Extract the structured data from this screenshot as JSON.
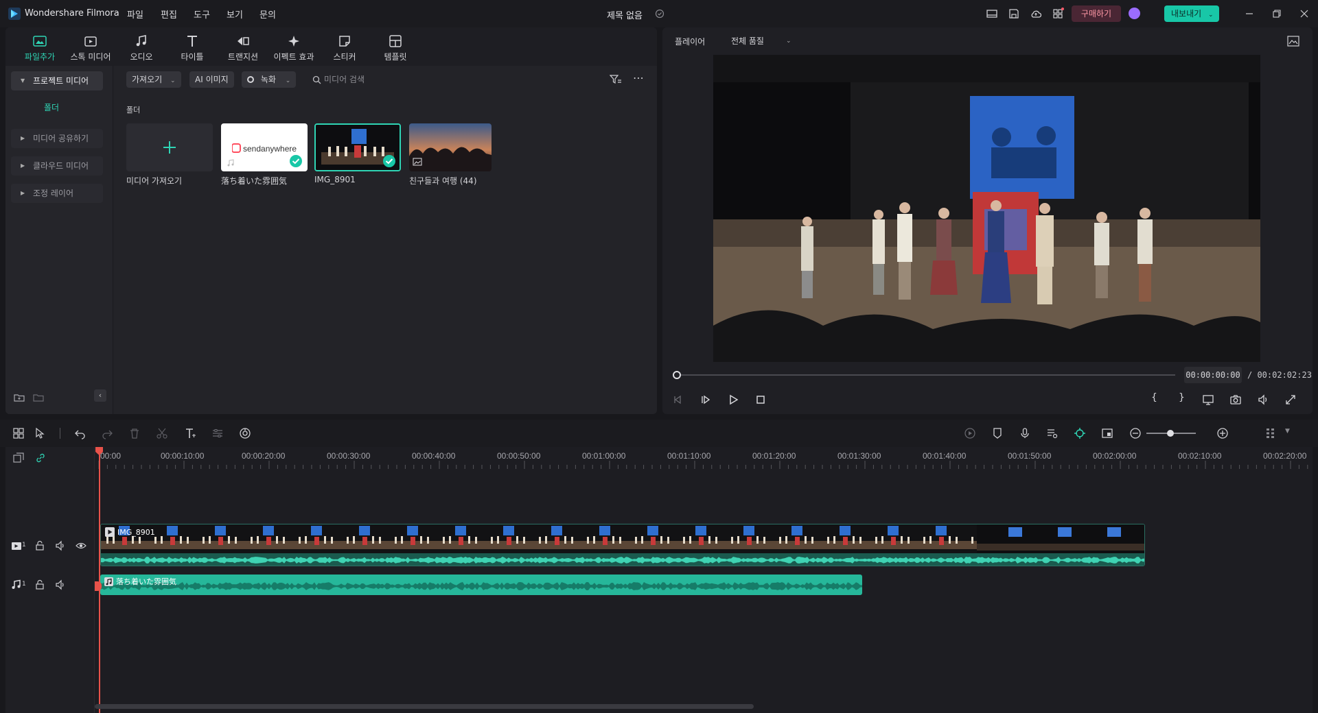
{
  "app": {
    "name": "Wondershare Filmora",
    "menus": [
      "파일",
      "편집",
      "도구",
      "보기",
      "문의"
    ],
    "project_title": "제목 없음",
    "buy_label": "구매하기",
    "export_label": "내보내기"
  },
  "media_tabs": [
    {
      "label": "파일추가",
      "icon": "import-media-icon"
    },
    {
      "label": "스톡 미디어",
      "icon": "stock-media-icon"
    },
    {
      "label": "오디오",
      "icon": "music-note-icon"
    },
    {
      "label": "타이틀",
      "icon": "title-t-icon"
    },
    {
      "label": "트랜지션",
      "icon": "transition-icon"
    },
    {
      "label": "이펙트 효과",
      "icon": "effects-icon"
    },
    {
      "label": "스티커",
      "icon": "sticker-icon"
    },
    {
      "label": "템플릿",
      "icon": "template-icon"
    }
  ],
  "left_nav": {
    "project_media": "프로젝트 미디어",
    "folder": "폴더",
    "items": [
      "미디어 공유하기",
      "클라우드 미디어",
      "조정 레이어"
    ]
  },
  "media_toolbar": {
    "import_label": "가져오기",
    "ai_image_label": "AI 이미지",
    "record_label": "녹화",
    "search_placeholder": "미디어 검색"
  },
  "folder_label": "폴더",
  "media_items": [
    {
      "label": "미디어 가져오기"
    },
    {
      "label": "落ち着いた雰囲気"
    },
    {
      "label": "IMG_8901"
    },
    {
      "label": "친구들과 여행  (44)"
    }
  ],
  "player": {
    "label": "플레이어",
    "quality": "전체 품질",
    "current_time": "00:00:00:00",
    "total_time": "/ 00:02:02:23",
    "progress": 0
  },
  "timeline": {
    "ruler": [
      "00:00",
      "00:00:10:00",
      "00:00:20:00",
      "00:00:30:00",
      "00:00:40:00",
      "00:00:50:00",
      "00:01:00:00",
      "00:01:10:00",
      "00:01:20:00",
      "00:01:30:00",
      "00:01:40:00",
      "00:01:50:00",
      "00:02:00:00",
      "00:02:10:00",
      "00:02:20:00"
    ],
    "video_track_number": "1",
    "audio_track_number": "1",
    "video_clip_name": "IMG_8901",
    "audio_clip_name": "落ち着いた雰囲気"
  },
  "colors": {
    "accent": "#18c7a7",
    "audio_clip": "#26b79a",
    "playhead": "#e8524a",
    "buy": "#ff98a6"
  }
}
